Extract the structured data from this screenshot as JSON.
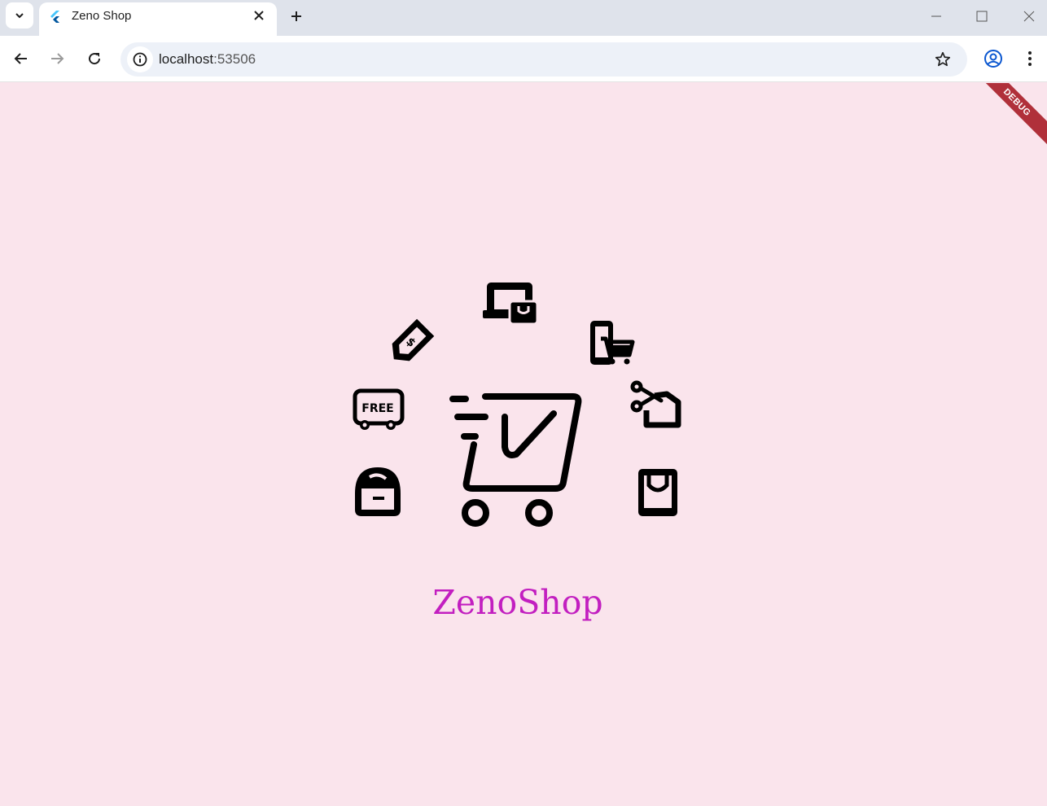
{
  "browser": {
    "tab_title": "Zeno Shop",
    "url_host": "localhost",
    "url_port": ":53506"
  },
  "app": {
    "debug_banner": "DEBUG",
    "logo_badge_text": "FREE",
    "brand_name": "ZenoShop",
    "brand_color": "#c21fc0",
    "background_color": "#fae4ec"
  },
  "icons": [
    "cart-check-icon",
    "laptop-bag-icon",
    "price-tag-icon",
    "mobile-cart-icon",
    "free-delivery-truck-icon",
    "coupon-scissors-icon",
    "piggy-bank-icon",
    "shopping-bag-icon"
  ]
}
